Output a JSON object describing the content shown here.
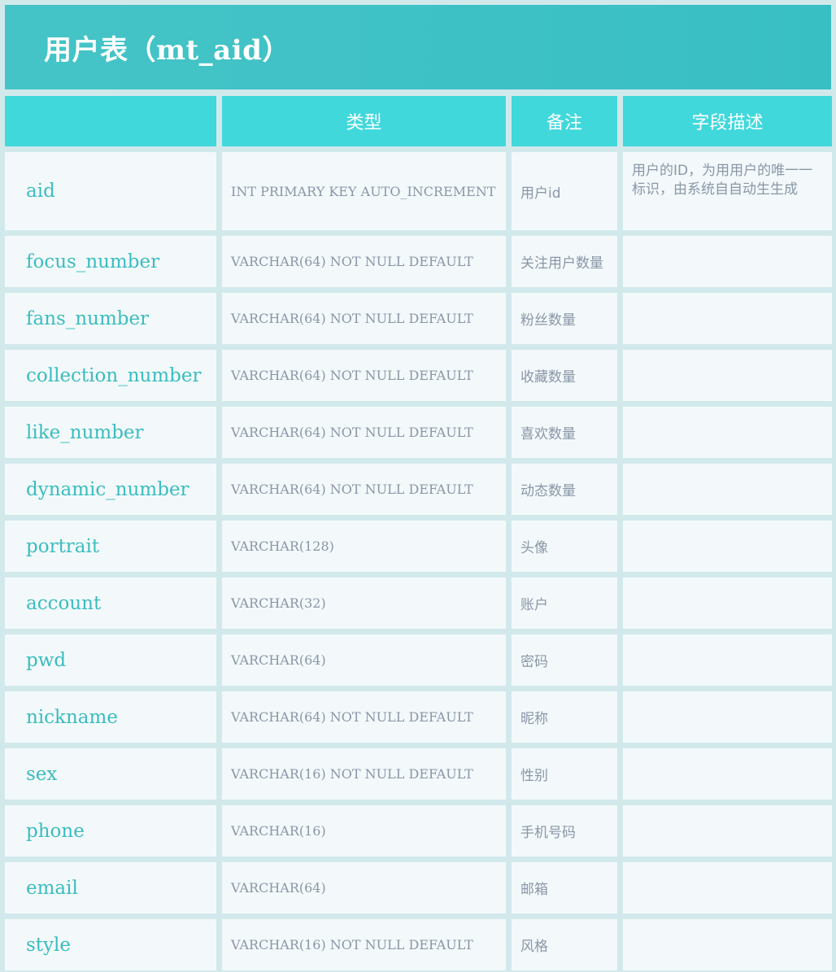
{
  "title": "用户表（mt_aid）",
  "headers": [
    "",
    "类型",
    "备注",
    "字段描述"
  ],
  "rows": [
    {
      "name": "aid",
      "type": "INT PRIMARY KEY AUTO_INCREMENT",
      "note": "用户id",
      "desc": "用户的ID，为用用户的唯一一标识，由系统自自动生生成"
    },
    {
      "name": "focus_number",
      "type": "VARCHAR(64) NOT NULL DEFAULT",
      "note": "关注用户数量",
      "desc": ""
    },
    {
      "name": "fans_number",
      "type": "VARCHAR(64) NOT NULL DEFAULT",
      "note": "粉丝数量",
      "desc": ""
    },
    {
      "name": "collection_number",
      "type": "VARCHAR(64) NOT NULL DEFAULT",
      "note": "收藏数量",
      "desc": ""
    },
    {
      "name": "like_number",
      "type": "VARCHAR(64) NOT NULL DEFAULT",
      "note": "喜欢数量",
      "desc": ""
    },
    {
      "name": "dynamic_number",
      "type": "VARCHAR(64) NOT NULL DEFAULT",
      "note": "动态数量",
      "desc": ""
    },
    {
      "name": "portrait",
      "type": "VARCHAR(128)",
      "note": "头像",
      "desc": ""
    },
    {
      "name": "account",
      "type": "VARCHAR(32)",
      "note": "账户",
      "desc": ""
    },
    {
      "name": "pwd",
      "type": "VARCHAR(64)",
      "note": "密码",
      "desc": ""
    },
    {
      "name": "nickname",
      "type": "VARCHAR(64) NOT NULL DEFAULT",
      "note": "昵称",
      "desc": ""
    },
    {
      "name": "sex",
      "type": "VARCHAR(16) NOT NULL DEFAULT",
      "note": "性别",
      "desc": ""
    },
    {
      "name": "phone",
      "type": "VARCHAR(16)",
      "note": "手机号码",
      "desc": ""
    },
    {
      "name": "email",
      "type": "VARCHAR(64)",
      "note": "邮箱",
      "desc": ""
    },
    {
      "name": "style",
      "type": "VARCHAR(16) NOT NULL DEFAULT",
      "note": "风格",
      "desc": ""
    }
  ]
}
